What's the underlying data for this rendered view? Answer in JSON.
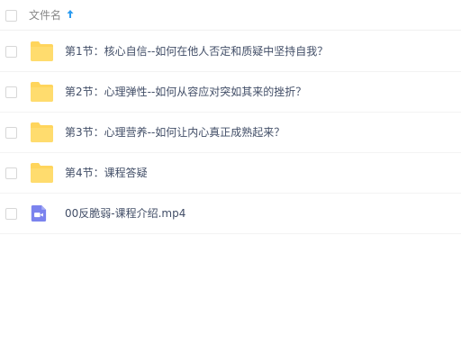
{
  "header": {
    "column_label": "文件名",
    "sort_icon": "arrow-up-icon"
  },
  "files": [
    {
      "name": "第1节：核心自信--如何在他人否定和质疑中坚持自我？",
      "type": "folder",
      "icon": "folder-icon"
    },
    {
      "name": "第2节：心理弹性--如何从容应对突如其来的挫折？",
      "type": "folder",
      "icon": "folder-icon"
    },
    {
      "name": "第3节：心理营养--如何让内心真正成熟起来？",
      "type": "folder",
      "icon": "folder-icon"
    },
    {
      "name": "第4节：课程答疑",
      "type": "folder",
      "icon": "folder-icon"
    },
    {
      "name": "00反脆弱-课程介绍.mp4",
      "type": "video",
      "icon": "video-file-icon"
    }
  ],
  "colors": {
    "folder": "#ffd55c",
    "video": "#7b83ee",
    "sort_arrow": "#2b9bf0",
    "text": "#424e67",
    "header_text": "#888888"
  }
}
